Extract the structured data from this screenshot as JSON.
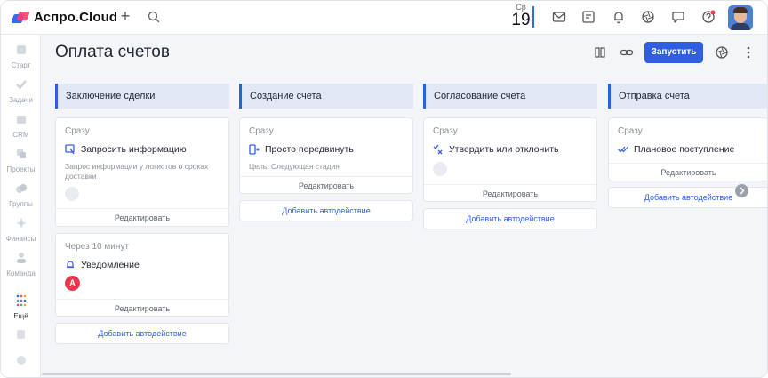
{
  "app": {
    "name": "Аспро.Cloud"
  },
  "topbar": {
    "date_dow": "Ср",
    "date_day": "19"
  },
  "sidebar": {
    "items": [
      {
        "label": "Старт",
        "icon": "home-icon"
      },
      {
        "label": "Задачи",
        "icon": "tasks-icon"
      },
      {
        "label": "CRM",
        "icon": "crm-icon"
      },
      {
        "label": "Проекты",
        "icon": "projects-icon"
      },
      {
        "label": "Группы",
        "icon": "groups-icon"
      },
      {
        "label": "Финансы",
        "icon": "finance-icon"
      },
      {
        "label": "Команда",
        "icon": "team-icon"
      },
      {
        "label": "Ещё",
        "icon": "apps-grid-icon"
      }
    ]
  },
  "page": {
    "title": "Оплата счетов",
    "run_label": "Запустить"
  },
  "columns": [
    {
      "title": "Заключение сделки",
      "cards": [
        {
          "when": "Сразу",
          "action": "Запросить информацию",
          "desc": "Запрос информации у логистов о сроках доставки",
          "edit": "Редактировать"
        },
        {
          "when": "Через 10 минут",
          "action": "Уведомление",
          "avatar": "А",
          "edit": "Редактировать"
        }
      ],
      "add": "Добавить автодействие"
    },
    {
      "title": "Создание счета",
      "cards": [
        {
          "when": "Сразу",
          "action": "Просто передвинуть",
          "desc": "Цель: Следующая стадия",
          "edit": "Редактировать"
        }
      ],
      "add": "Добавить автодействие"
    },
    {
      "title": "Согласование счета",
      "cards": [
        {
          "when": "Сразу",
          "action": "Утвердить или отклонить",
          "edit": "Редактировать"
        }
      ],
      "add": "Добавить автодействие"
    },
    {
      "title": "Отправка счета",
      "cards": [
        {
          "when": "Сразу",
          "action": "Плановое поступление",
          "edit": "Редактировать"
        }
      ],
      "add": "Добавить автодействие"
    }
  ],
  "colors": {
    "accent": "#2f5fe0",
    "column_header": "#e3e8f7",
    "danger": "#e8374f"
  }
}
